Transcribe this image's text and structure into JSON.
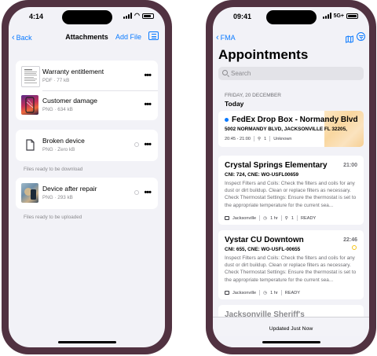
{
  "left": {
    "status_time": "4:14",
    "nav": {
      "back_label": "Back",
      "title": "Attachments",
      "add_label": "Add File"
    },
    "group1": [
      {
        "name": "Warranty entitlement",
        "meta": "PDF · 77 kB"
      },
      {
        "name": "Customer damage",
        "meta": "PNG · 634 kB"
      }
    ],
    "group2": {
      "name": "Broken device",
      "meta": "PNG · Zero kB",
      "footnote": "Files ready to be download"
    },
    "group3": {
      "name": "Device after repair",
      "meta": "PNG · 293 kB",
      "footnote": "Files ready to be uploaded"
    },
    "more_glyph": "•••"
  },
  "right": {
    "status_time": "09:41",
    "network": "5G+",
    "nav": {
      "back_label": "FMA"
    },
    "title": "Appointments",
    "search_placeholder": "Search",
    "section_date": "FRIDAY, 20 DECEMBER",
    "section_day": "Today",
    "appointments": [
      {
        "title": "FedEx Drop Box - Normandy Blvd",
        "address": "5002 NORMANDY BLVD, JACKSONVILLE FL 32205,",
        "tags": [
          "20:45 - 21:00",
          "1",
          "Unknown"
        ]
      },
      {
        "title": "Crystal Springs Elementary",
        "time": "21:00",
        "sub": "CNI: 724, CNE: WO-USFL00659",
        "desc": "Inspect Filters and Coils: Check the filters and coils for any dust or dirt buildup. Clean or replace filters as necessary. Check Thermostat Settings: Ensure the thermostat is set to the appropriate temperature for the current sea...",
        "tags": [
          "Jacksonville",
          "1 hr",
          "1",
          "READY"
        ]
      },
      {
        "title": "Vystar CU Downtown",
        "time": "22:46",
        "sub": "CNI: 655, CNE: WO-USFL-00655",
        "desc": "Inspect Filters and Coils: Check the filters and coils for any dust or dirt buildup. Clean or replace filters as necessary. Check Thermostat Settings: Ensure the thermostat is set to the appropriate temperature for the current sea...",
        "tags": [
          "Jacksonville",
          "1 hr",
          "READY"
        ]
      },
      {
        "title": "Jacksonville Sheriff's"
      }
    ],
    "updated_label": "Updated Just Now"
  },
  "colors": {
    "accent": "#0a7aff",
    "frame": "#513241",
    "background": "#f2f2f7"
  }
}
